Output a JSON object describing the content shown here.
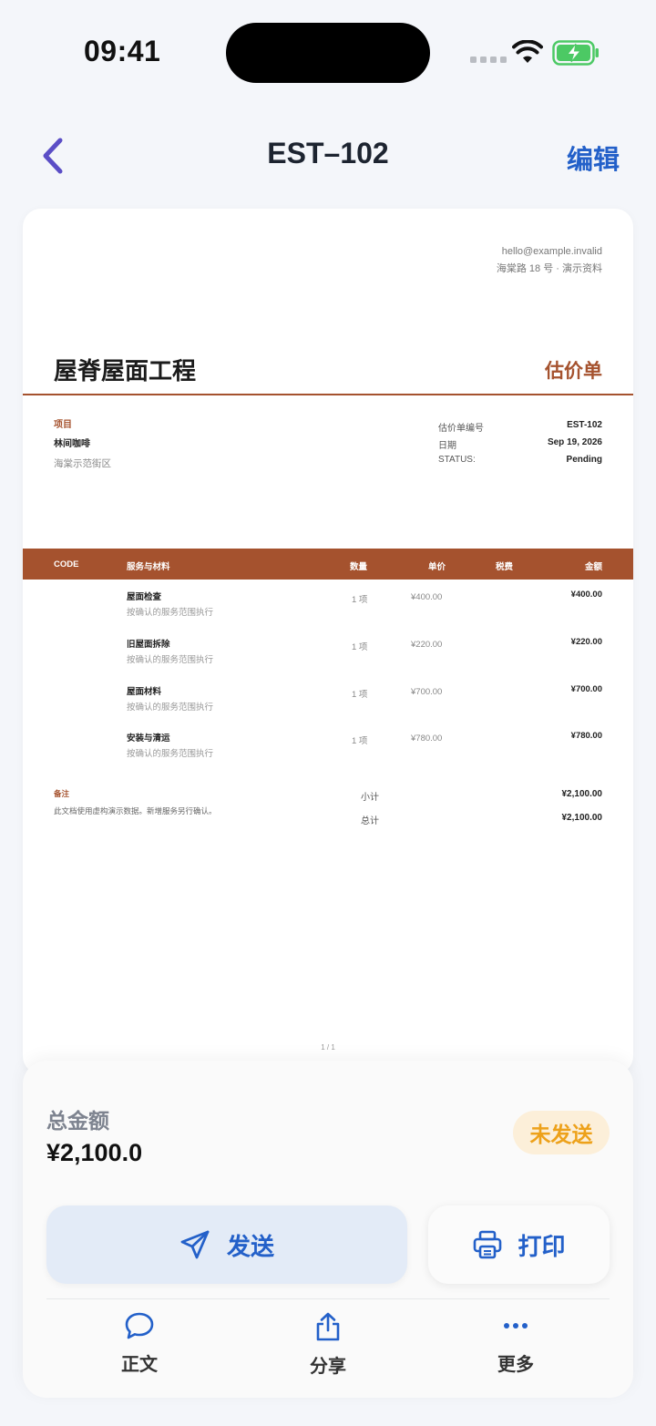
{
  "status_bar": {
    "time": "09:41"
  },
  "nav": {
    "title": "EST–102",
    "edit_label": "编辑"
  },
  "document": {
    "email": "hello@example.invalid",
    "address": "海棠路 18 号 · 演示资料",
    "company": "屋脊屋面工程",
    "doc_type": "估价单",
    "project_label": "项目",
    "client": "林间咖啡",
    "location": "海棠示范街区",
    "meta": [
      {
        "key": "估价单编号",
        "value": "EST-102"
      },
      {
        "key": "日期",
        "value": "Sep 19, 2026"
      },
      {
        "key": "STATUS:",
        "value": "Pending"
      }
    ],
    "columns": {
      "code": "CODE",
      "service": "服务与材料",
      "qty": "数量",
      "price": "单价",
      "tax": "税费",
      "amount": "金额"
    },
    "items": [
      {
        "name": "屋面检查",
        "desc": "按确认的服务范围执行",
        "qty": "1 项",
        "price": "¥400.00",
        "amount": "¥400.00"
      },
      {
        "name": "旧屋面拆除",
        "desc": "按确认的服务范围执行",
        "qty": "1 项",
        "price": "¥220.00",
        "amount": "¥220.00"
      },
      {
        "name": "屋面材料",
        "desc": "按确认的服务范围执行",
        "qty": "1 项",
        "price": "¥700.00",
        "amount": "¥700.00"
      },
      {
        "name": "安装与清运",
        "desc": "按确认的服务范围执行",
        "qty": "1 项",
        "price": "¥780.00",
        "amount": "¥780.00"
      }
    ],
    "notes_label": "备注",
    "notes_text": "此文档使用虚构演示数据。新增服务另行确认。",
    "subtotal_label": "小计",
    "subtotal_value": "¥2,100.00",
    "total_label": "总计",
    "total_value": "¥2,100.00",
    "page_indicator": "1 / 1"
  },
  "summary": {
    "total_label": "总金额",
    "total_value": "¥2,100.0",
    "status_badge": "未发送"
  },
  "actions": {
    "send_label": "发送",
    "print_label": "打印"
  },
  "tabs": [
    {
      "label": "正文",
      "icon": "message-bubble-icon"
    },
    {
      "label": "分享",
      "icon": "share-icon"
    },
    {
      "label": "更多",
      "icon": "more-icon"
    }
  ],
  "colors": {
    "accent": "#a5522e",
    "link": "#2360c9",
    "badge_text": "#eda11a",
    "badge_bg": "#fcefd9",
    "send_bg": "#e3ebf7"
  }
}
